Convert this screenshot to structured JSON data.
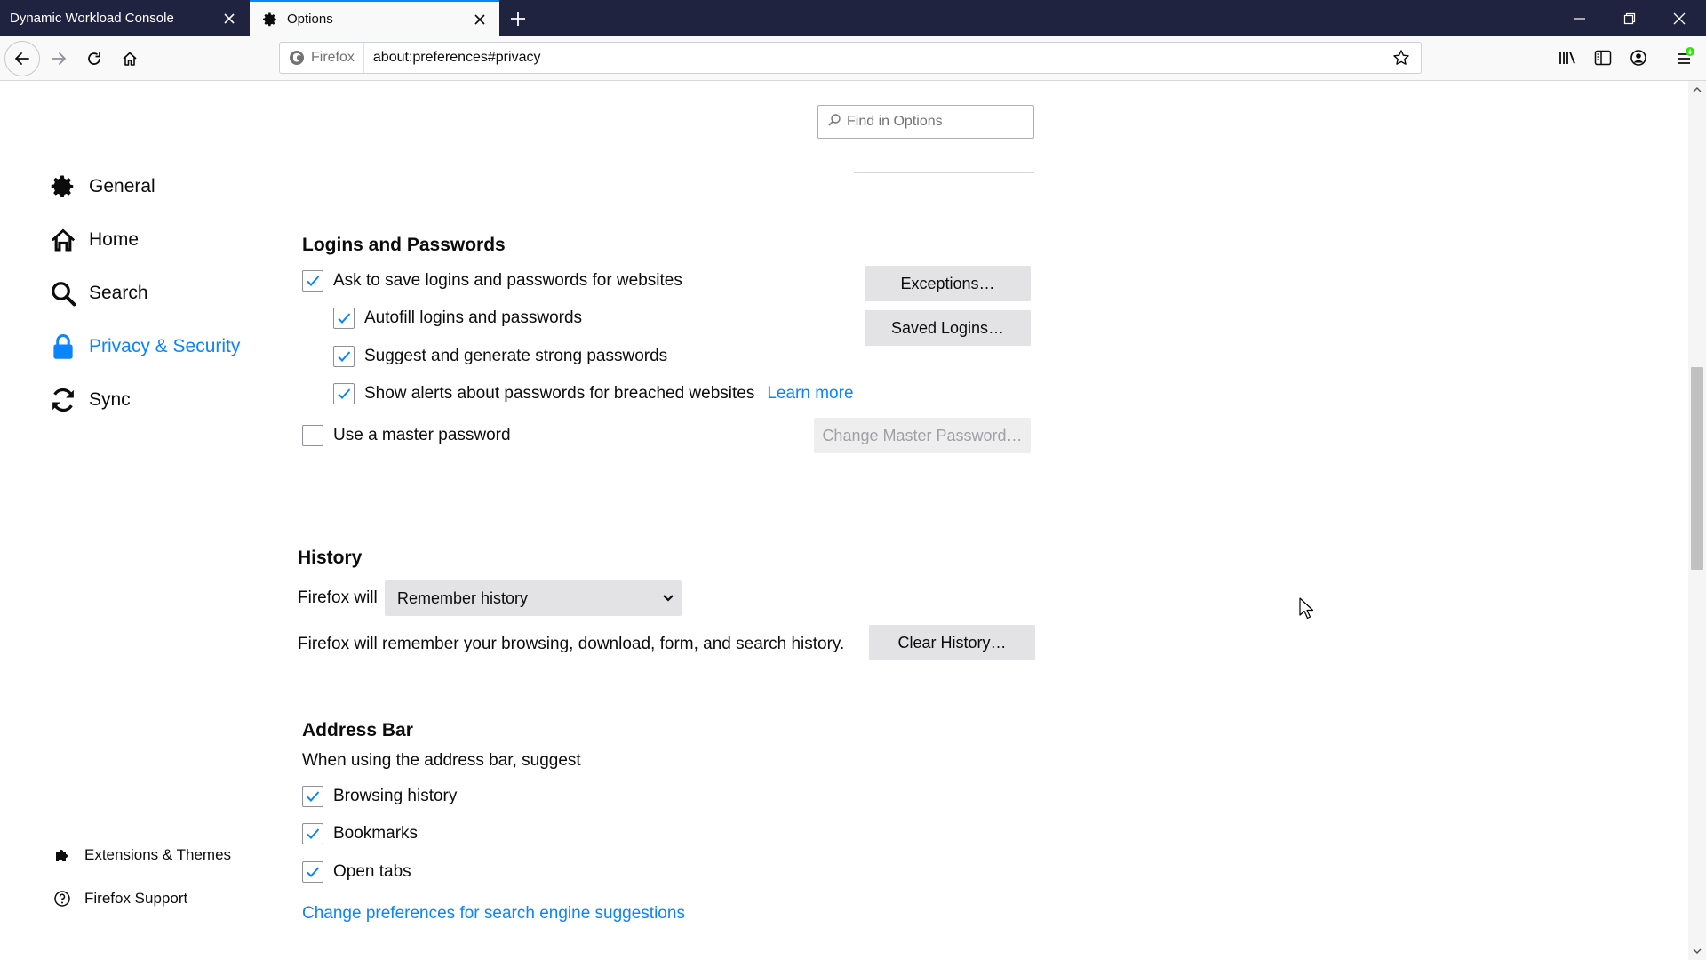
{
  "tabs": [
    {
      "title": "Dynamic Workload Console",
      "active": false
    },
    {
      "title": "Options",
      "active": true
    }
  ],
  "urlbar": {
    "identity_label": "Firefox",
    "url": "about:preferences#privacy"
  },
  "search": {
    "placeholder": "Find in Options"
  },
  "sidebar": {
    "items": [
      {
        "label": "General",
        "icon": "gear-icon",
        "selected": false
      },
      {
        "label": "Home",
        "icon": "home-icon",
        "selected": false
      },
      {
        "label": "Search",
        "icon": "search-icon",
        "selected": false
      },
      {
        "label": "Privacy & Security",
        "icon": "lock-icon",
        "selected": true
      },
      {
        "label": "Sync",
        "icon": "sync-icon",
        "selected": false
      }
    ],
    "footer": [
      {
        "label": "Extensions & Themes",
        "icon": "puzzle-icon"
      },
      {
        "label": "Firefox Support",
        "icon": "help-icon"
      }
    ]
  },
  "logins": {
    "heading": "Logins and Passwords",
    "ask_save": {
      "label": "Ask to save logins and passwords for websites",
      "checked": true
    },
    "autofill": {
      "label": "Autofill logins and passwords",
      "checked": true
    },
    "suggest": {
      "label": "Suggest and generate strong passwords",
      "checked": true
    },
    "alerts": {
      "label": "Show alerts about passwords for breached websites",
      "checked": true
    },
    "learn_more": "Learn more",
    "master": {
      "label": "Use a master password",
      "checked": false
    },
    "exceptions_button": "Exceptions…",
    "saved_logins_button": "Saved Logins…",
    "change_master_button": "Change Master Password…"
  },
  "history": {
    "heading": "History",
    "firefox_will_label": "Firefox will",
    "mode_selected": "Remember history",
    "description": "Firefox will remember your browsing, download, form, and search history.",
    "clear_button": "Clear History…"
  },
  "address_bar": {
    "heading": "Address Bar",
    "subheading": "When using the address bar, suggest",
    "browsing_history": {
      "label": "Browsing history",
      "checked": true
    },
    "bookmarks": {
      "label": "Bookmarks",
      "checked": true
    },
    "open_tabs": {
      "label": "Open tabs",
      "checked": true
    },
    "change_prefs_link": "Change preferences for search engine suggestions"
  },
  "colors": {
    "tabstrip": "#202340",
    "accent": "#0a84ff",
    "notification_badge": "#30e60b"
  }
}
